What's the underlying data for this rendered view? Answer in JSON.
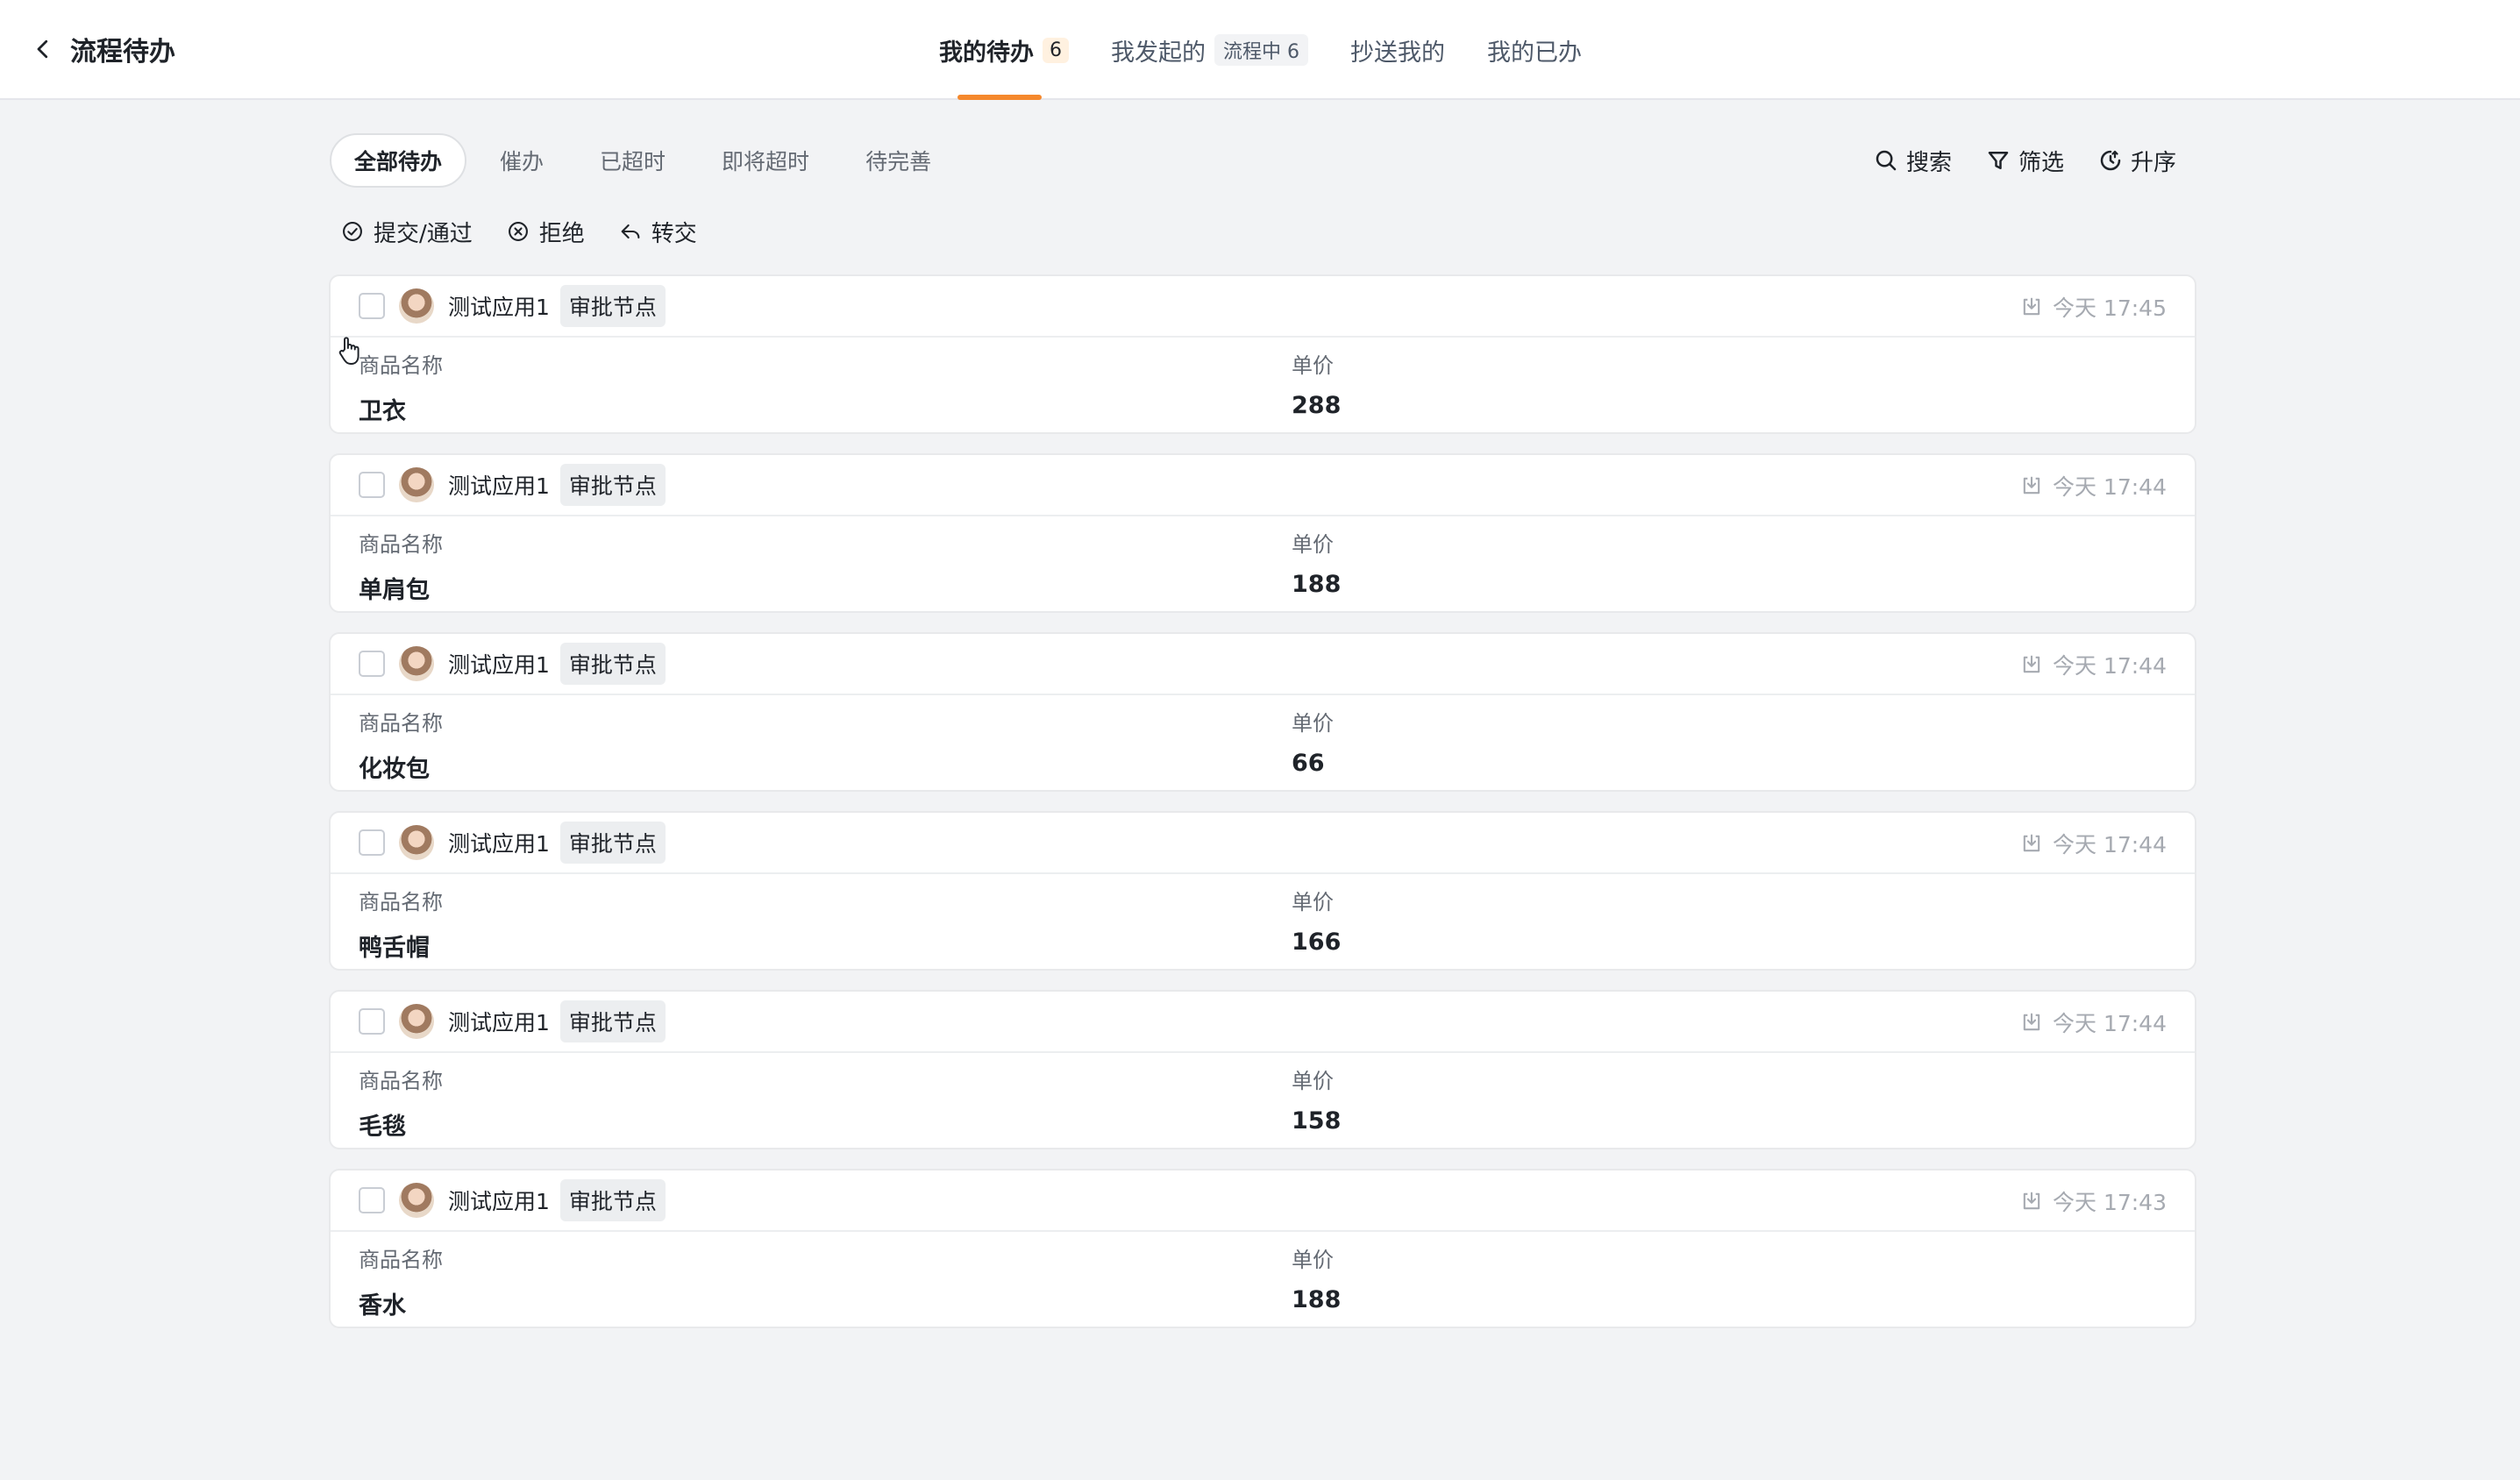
{
  "header": {
    "back_title": "流程待办",
    "tabs": [
      {
        "label": "我的待办",
        "badge": "6"
      },
      {
        "label": "我发起的",
        "pill": "流程中 6"
      },
      {
        "label": "抄送我的"
      },
      {
        "label": "我的已办"
      }
    ]
  },
  "filters": [
    "全部待办",
    "催办",
    "已超时",
    "即将超时",
    "待完善"
  ],
  "tools": {
    "search": "搜索",
    "filter": "筛选",
    "sort": "升序"
  },
  "actions": {
    "submit": "提交/通过",
    "reject": "拒绝",
    "transfer": "转交"
  },
  "field_labels": {
    "name": "商品名称",
    "price": "单价"
  },
  "items": [
    {
      "app": "测试应用1",
      "node": "审批节点",
      "time": "今天 17:45",
      "name": "卫衣",
      "price": "288"
    },
    {
      "app": "测试应用1",
      "node": "审批节点",
      "time": "今天 17:44",
      "name": "单肩包",
      "price": "188"
    },
    {
      "app": "测试应用1",
      "node": "审批节点",
      "time": "今天 17:44",
      "name": "化妆包",
      "price": "66"
    },
    {
      "app": "测试应用1",
      "node": "审批节点",
      "time": "今天 17:44",
      "name": "鸭舌帽",
      "price": "166"
    },
    {
      "app": "测试应用1",
      "node": "审批节点",
      "time": "今天 17:44",
      "name": "毛毯",
      "price": "158"
    },
    {
      "app": "测试应用1",
      "node": "审批节点",
      "time": "今天 17:43",
      "name": "香水",
      "price": "188"
    }
  ],
  "colors": {
    "accent": "#f5882c",
    "tag_bg": "#eceef0",
    "page_bg": "#f2f3f5"
  }
}
